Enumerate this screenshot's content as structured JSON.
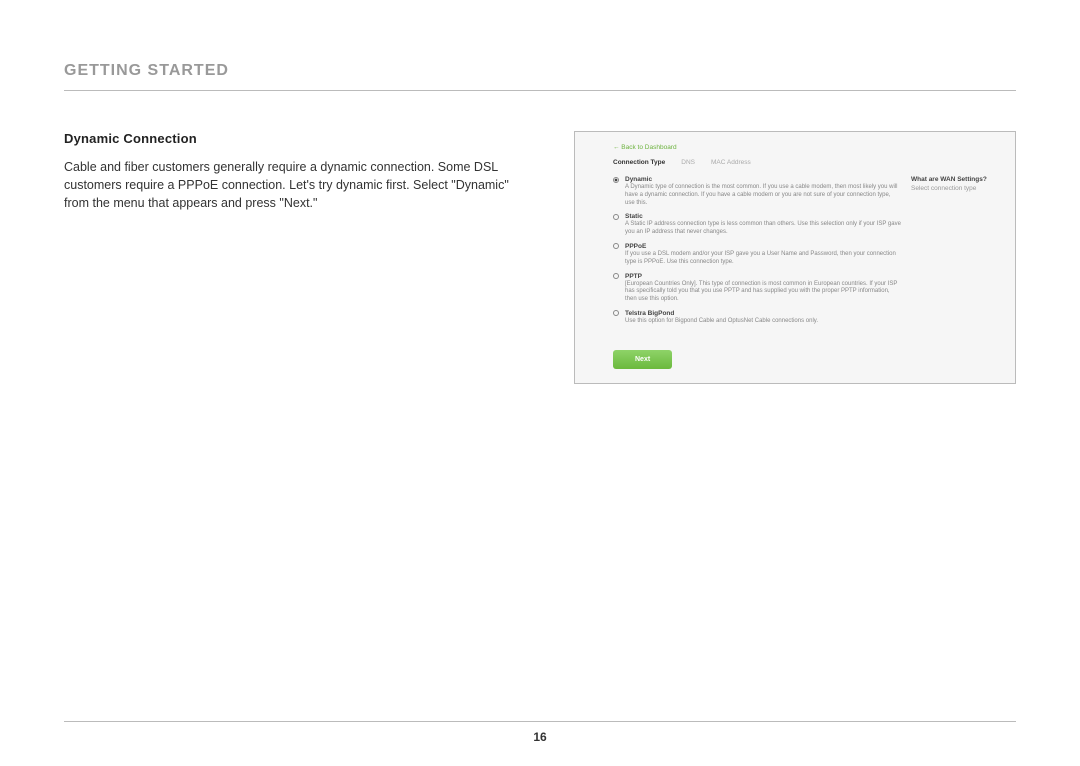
{
  "section_title": "GETTING STARTED",
  "subheading": "Dynamic Connection",
  "body_text": "Cable and fiber customers generally require a dynamic connection. Some DSL customers require a PPPoE connection. Let's try dynamic first. Select \"Dynamic\" from the menu that appears and press \"Next.\"",
  "panel": {
    "back_link": "← Back to Dashboard",
    "tabs": {
      "connection_type": "Connection Type",
      "dns": "DNS",
      "mac": "MAC Address"
    },
    "sidebar": {
      "title": "What are WAN Settings?",
      "sub": "Select connection type"
    },
    "options": {
      "dynamic": {
        "label": "Dynamic",
        "desc": "A Dynamic type of connection is the most common. If you use a cable modem, then most likely you will have a dynamic connection. If you have a cable modem or you are not sure of your connection type, use this."
      },
      "static": {
        "label": "Static",
        "desc": "A Static IP address connection type is less common than others. Use this selection only if your ISP gave you an IP address that never changes."
      },
      "pppoe": {
        "label": "PPPoE",
        "desc": "If you use a DSL modem and/or your ISP gave you a User Name and Password, then your connection type is PPPoE. Use this connection type."
      },
      "pptp": {
        "label": "PPTP",
        "desc": "[European Countries Only]. This type of connection is most common in European countries. If your ISP has specifically told you that you use PPTP and has supplied you with the proper PPTP information, then use this option."
      },
      "telstra": {
        "label": "Telstra BigPond",
        "desc": "Use this option for Bigpond Cable and OptusNet Cable connections only."
      }
    },
    "next_label": "Next"
  },
  "page_number": "16"
}
